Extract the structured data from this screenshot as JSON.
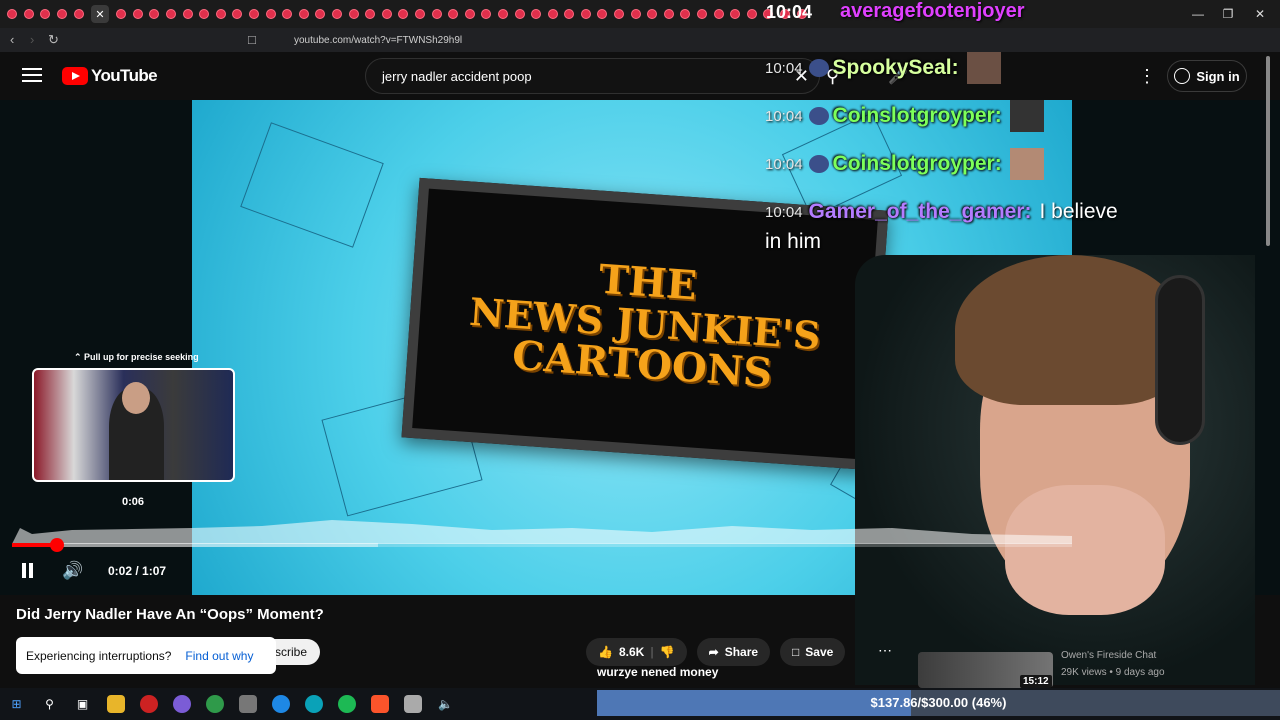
{
  "browser": {
    "url": "youtube.com/watch?v=FTWNSh29h9l",
    "tab_close_glyph": "✕"
  },
  "youtube": {
    "logo_text": "YouTube",
    "search_query": "jerry nadler accident poop",
    "sign_in_label": "Sign in"
  },
  "stream_overlay": {
    "clock": "10:04",
    "top_username": "averagefootenjoyer",
    "chat": [
      {
        "time": "10:04",
        "user": "SpookySeal:",
        "user_color": "#d6ff9e",
        "message": ""
      },
      {
        "time": "10:04",
        "user": "Coinslotgroyper:",
        "user_color": "#7dff5a",
        "message": ""
      },
      {
        "time": "10:04",
        "user": "Coinslotgroyper:",
        "user_color": "#7dff5a",
        "message": ""
      },
      {
        "time": "10:04",
        "user": "Gamer_of_the_gamer:",
        "user_color": "#b47cff",
        "message": "I believe",
        "message_cont": "in him"
      }
    ],
    "bottom_text": "wurzye nened money",
    "goal": {
      "label": "$137.86/$300.00 (46%)",
      "fraction": 0.46
    }
  },
  "video_frame": {
    "sign_line1": "THE",
    "sign_line2": "NEWS JUNKIE'S",
    "sign_line3": "CARTOONS"
  },
  "player": {
    "seek_hint": "Pull up for precise seeking",
    "preview_time": "0:06",
    "current_time_display": "0:02 / 1:07",
    "progress_fraction": 0.042,
    "buffered_fraction": 0.345
  },
  "video_info": {
    "title": "Did Jerry Nadler Have An “Oops” Moment?",
    "likes": "8.6K",
    "share_label": "Share",
    "save_label": "Save",
    "subscribe_partial": "scribe"
  },
  "toast": {
    "message": "Experiencing interruptions?",
    "link": "Find out why"
  },
  "sidebar_next": {
    "channel": "Owen's Fireside Chat",
    "meta": "29K views • 9 days ago",
    "duration": "15:12"
  },
  "colors": {
    "youtube_red": "#ff0000",
    "background": "#0f0f0f",
    "sign_text": "#f5a21a"
  }
}
